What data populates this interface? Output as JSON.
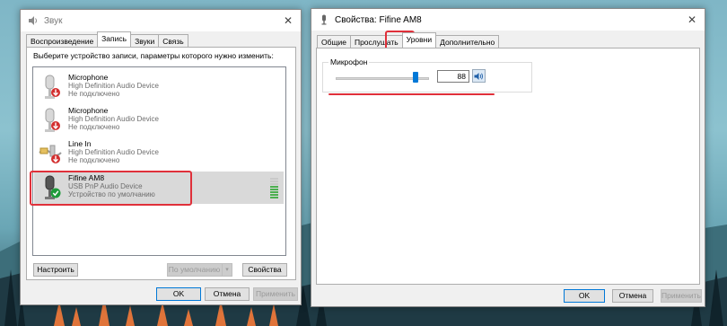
{
  "colors": {
    "accent": "#0078d7",
    "highlight": "#e0303a",
    "status_ok": "#1e9b3a",
    "status_err": "#d32f2f"
  },
  "sound": {
    "title": "Звук",
    "tabs": [
      "Воспроизведение",
      "Запись",
      "Звуки",
      "Связь"
    ],
    "active_tab": "Запись",
    "instruction": "Выберите устройство записи, параметры которого нужно изменить:",
    "devices": [
      {
        "name": "Microphone",
        "line1": "High Definition Audio Device",
        "line2": "Не подключено",
        "status": "disconnected",
        "icon": "microphone-icon"
      },
      {
        "name": "Microphone",
        "line1": "High Definition Audio Device",
        "line2": "Не подключено",
        "status": "disconnected",
        "icon": "microphone-icon"
      },
      {
        "name": "Line In",
        "line1": "High Definition Audio Device",
        "line2": "Не подключено",
        "status": "disconnected",
        "icon": "line-in-cable-icon"
      },
      {
        "name": "Fifine AM8",
        "line1": "USB PnP Audio Device",
        "line2": "Устройство по умолчанию",
        "status": "default",
        "icon": "microphone-icon"
      }
    ],
    "configure_btn": "Настроить",
    "default_btn": "По умолчанию",
    "properties_btn": "Свойства",
    "ok_btn": "OK",
    "cancel_btn": "Отмена",
    "apply_btn": "Применить"
  },
  "props": {
    "title": "Свойства: Fifine AM8",
    "tabs": [
      "Общие",
      "Прослушать",
      "Уровни",
      "Дополнительно"
    ],
    "active_tab": "Уровни",
    "group_label": "Микрофон",
    "level_value": "88",
    "level_fraction": 0.88,
    "ok_btn": "OK",
    "cancel_btn": "Отмена",
    "apply_btn": "Применить"
  }
}
